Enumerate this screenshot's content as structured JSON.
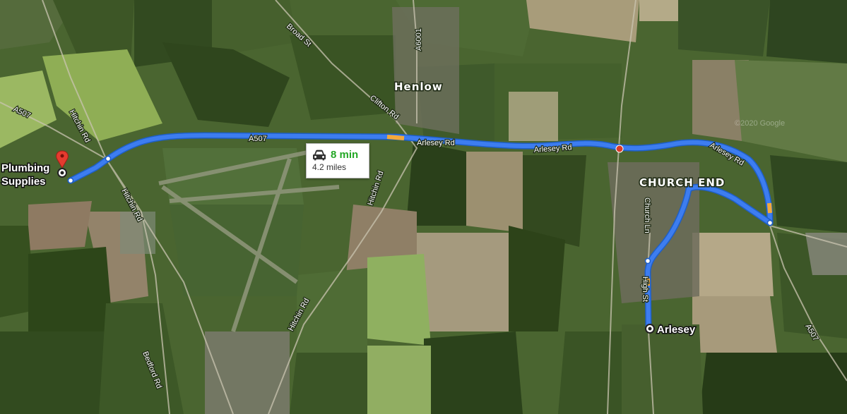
{
  "route": {
    "origin_label_line1": "Plumbing",
    "origin_label_line2": "Supplies",
    "destination_label": "Arlesey",
    "duration": "8 min",
    "distance": "4.2 miles",
    "mode_icon": "car-icon",
    "route_color": "#3d7df0",
    "traffic_color": "#f4a93c",
    "duration_color": "#24a826"
  },
  "places": {
    "henlow": "Henlow",
    "church_end": "CHURCH END"
  },
  "roads": {
    "broad_st": "Broad St",
    "a6001": "A6001",
    "clifton_rd": "Clifton Rd",
    "a507_west": "A507",
    "a507_center": "A507",
    "a507_east": "A507",
    "hitchin_rd_1": "Hitchin Rd",
    "hitchin_rd_2": "Hitchin Rd",
    "hitchin_rd_3": "Hitchin Rd",
    "hitchin_rd_4": "Hitchin Rd",
    "arlesey_rd_1": "Arlesey Rd",
    "arlesey_rd_2": "Arlesey Rd",
    "arlesey_rd_3": "Arlesey Rd",
    "church_ln": "Church Ln",
    "high_st": "High St",
    "bedford_rd": "Bedford Rd"
  },
  "watermark": "©2020 Google"
}
